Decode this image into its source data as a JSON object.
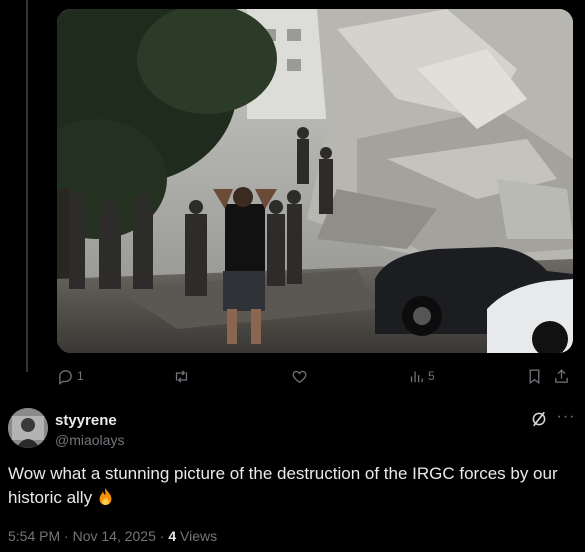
{
  "media": {
    "image_name": "building-rubble-photo"
  },
  "actions": {
    "reply_count": "1",
    "retweet_count": "",
    "like_count": "",
    "view_count": "5"
  },
  "author": {
    "display_name": "styyrene",
    "handle": "@miaolays"
  },
  "tweet": {
    "text": "Wow what a stunning picture of the destruction of the IRGC forces by our historic ally",
    "emoji": "fire-icon"
  },
  "meta": {
    "timestamp": "5:54 PM · Nov 14, 2025",
    "separator": " · ",
    "views": "4",
    "views_label": " Views"
  },
  "colors": {
    "background": "#000000",
    "text_primary": "#e7e9ea",
    "text_secondary": "#71767b",
    "divider": "#333639"
  }
}
